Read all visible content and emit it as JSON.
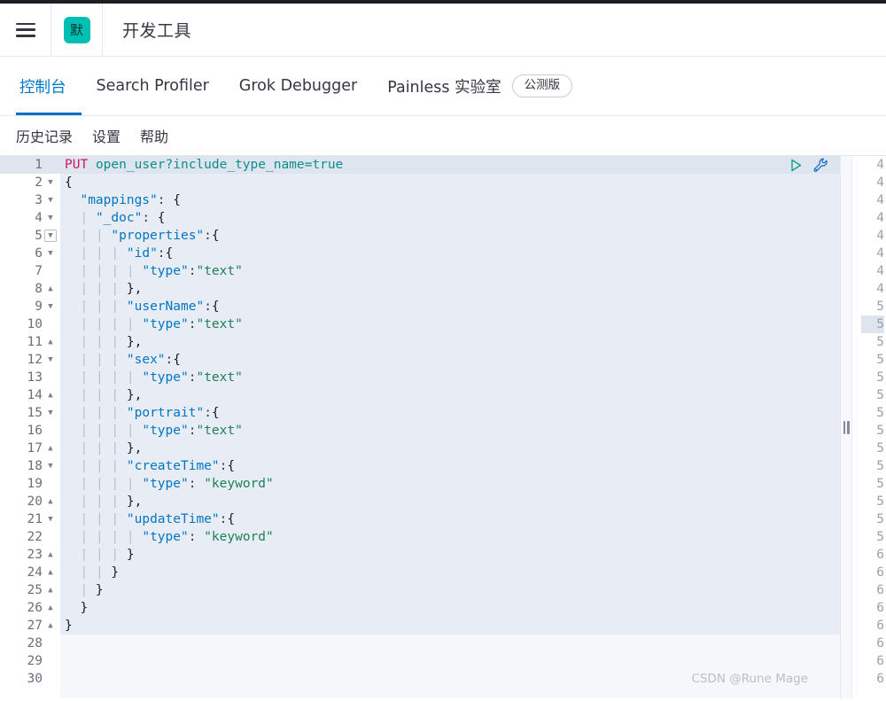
{
  "header": {
    "menu_icon": "hamburger-icon",
    "logo_char": "默",
    "logo_color": "#00bfb3",
    "title": "开发工具"
  },
  "tabs": [
    {
      "label": "控制台",
      "active": true
    },
    {
      "label": "Search Profiler",
      "active": false
    },
    {
      "label": "Grok Debugger",
      "active": false
    },
    {
      "label": "Painless 实验室",
      "active": false,
      "badge": "公测版"
    }
  ],
  "submenu": [
    {
      "label": "历史记录"
    },
    {
      "label": "设置"
    },
    {
      "label": "帮助"
    }
  ],
  "editor": {
    "active_line": 1,
    "total_lines": 30,
    "actions": [
      {
        "name": "run-request-button",
        "title": "▷"
      },
      {
        "name": "wrench-button",
        "title": "wrench"
      }
    ],
    "lines": [
      {
        "n": 1,
        "fold": "",
        "text": "PUT open_user?include_type_name=true"
      },
      {
        "n": 2,
        "fold": "down",
        "text": "{"
      },
      {
        "n": 3,
        "fold": "down",
        "text": "  \"mappings\": {"
      },
      {
        "n": 4,
        "fold": "down",
        "text": "    \"_doc\": {"
      },
      {
        "n": 5,
        "fold": "boxed",
        "text": "      \"properties\":{"
      },
      {
        "n": 6,
        "fold": "down",
        "text": "        \"id\":{"
      },
      {
        "n": 7,
        "fold": "",
        "text": "          \"type\":\"text\""
      },
      {
        "n": 8,
        "fold": "up",
        "text": "        },"
      },
      {
        "n": 9,
        "fold": "down",
        "text": "        \"userName\":{"
      },
      {
        "n": 10,
        "fold": "",
        "text": "          \"type\":\"text\""
      },
      {
        "n": 11,
        "fold": "up",
        "text": "        },"
      },
      {
        "n": 12,
        "fold": "down",
        "text": "        \"sex\":{"
      },
      {
        "n": 13,
        "fold": "",
        "text": "          \"type\":\"text\""
      },
      {
        "n": 14,
        "fold": "up",
        "text": "        },"
      },
      {
        "n": 15,
        "fold": "down",
        "text": "        \"portrait\":{"
      },
      {
        "n": 16,
        "fold": "",
        "text": "          \"type\":\"text\""
      },
      {
        "n": 17,
        "fold": "up",
        "text": "        },"
      },
      {
        "n": 18,
        "fold": "down",
        "text": "        \"createTime\":{"
      },
      {
        "n": 19,
        "fold": "",
        "text": "          \"type\": \"keyword\""
      },
      {
        "n": 20,
        "fold": "up",
        "text": "        },"
      },
      {
        "n": 21,
        "fold": "down",
        "text": "        \"updateTime\":{"
      },
      {
        "n": 22,
        "fold": "",
        "text": "          \"type\": \"keyword\""
      },
      {
        "n": 23,
        "fold": "up",
        "text": "        }"
      },
      {
        "n": 24,
        "fold": "up",
        "text": "      }"
      },
      {
        "n": 25,
        "fold": "up",
        "text": "    }"
      },
      {
        "n": 26,
        "fold": "up",
        "text": "  }"
      },
      {
        "n": 27,
        "fold": "up",
        "text": "}"
      },
      {
        "n": 28,
        "fold": "",
        "text": ""
      },
      {
        "n": 29,
        "fold": "",
        "text": ""
      },
      {
        "n": 30,
        "fold": "",
        "text": ""
      }
    ]
  },
  "response_panel": {
    "line_numbers": [
      "4",
      "4",
      "4",
      "4",
      "4",
      "4",
      "4",
      "4",
      "5",
      "5",
      "5",
      "5",
      "5",
      "5",
      "5",
      "5",
      "5",
      "5",
      "5",
      "5",
      "5",
      "5",
      "6",
      "6",
      "6",
      "6",
      "6",
      "6",
      "6",
      "6"
    ],
    "active_index": 9
  },
  "watermark": "CSDN @Rune Mage"
}
